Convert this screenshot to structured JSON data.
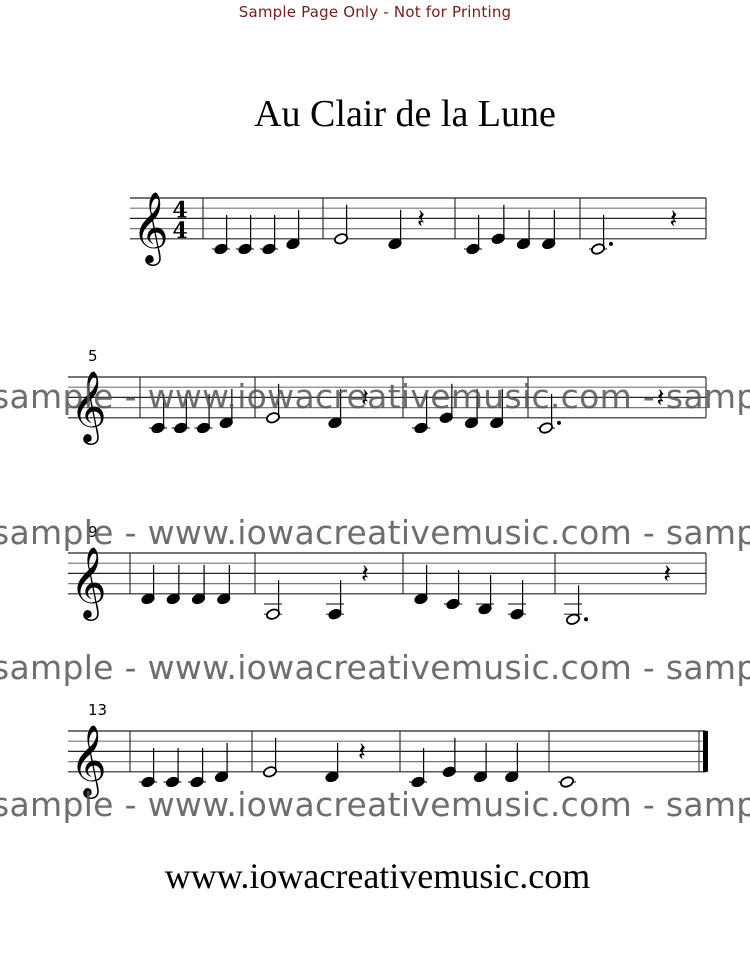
{
  "page": {
    "notice": "Sample Page Only - Not for Printing",
    "title": "Au Clair de la Lune",
    "footer": "www.iowacreativemusic.com",
    "watermark_text": "sample - www.iowacreativemusic.com - sample",
    "colors": {
      "notice": "#7a1a1a",
      "watermark": "#555555",
      "ink": "#000000"
    }
  },
  "score": {
    "clef": "treble",
    "time_signature": {
      "numerator": "4",
      "denominator": "4"
    },
    "systems": [
      {
        "measure_number": "",
        "measures": [
          [
            {
              "p": "C4",
              "d": "q"
            },
            {
              "p": "C4",
              "d": "q"
            },
            {
              "p": "C4",
              "d": "q"
            },
            {
              "p": "D4",
              "d": "q"
            }
          ],
          [
            {
              "p": "E4",
              "d": "h"
            },
            {
              "p": "D4",
              "d": "q"
            },
            {
              "p": "rest",
              "d": "q"
            }
          ],
          [
            {
              "p": "C4",
              "d": "q"
            },
            {
              "p": "E4",
              "d": "q"
            },
            {
              "p": "D4",
              "d": "q"
            },
            {
              "p": "D4",
              "d": "q"
            }
          ],
          [
            {
              "p": "C4",
              "d": "h."
            },
            {
              "p": "rest",
              "d": "q"
            }
          ]
        ]
      },
      {
        "measure_number": "5",
        "measures": [
          [
            {
              "p": "C4",
              "d": "q"
            },
            {
              "p": "C4",
              "d": "q"
            },
            {
              "p": "C4",
              "d": "q"
            },
            {
              "p": "D4",
              "d": "q"
            }
          ],
          [
            {
              "p": "E4",
              "d": "h"
            },
            {
              "p": "D4",
              "d": "q"
            },
            {
              "p": "rest",
              "d": "q"
            }
          ],
          [
            {
              "p": "C4",
              "d": "q"
            },
            {
              "p": "E4",
              "d": "q"
            },
            {
              "p": "D4",
              "d": "q"
            },
            {
              "p": "D4",
              "d": "q"
            }
          ],
          [
            {
              "p": "C4",
              "d": "h."
            },
            {
              "p": "rest",
              "d": "q"
            }
          ]
        ]
      },
      {
        "measure_number": "9",
        "measures": [
          [
            {
              "p": "D4",
              "d": "q"
            },
            {
              "p": "D4",
              "d": "q"
            },
            {
              "p": "D4",
              "d": "q"
            },
            {
              "p": "D4",
              "d": "q"
            }
          ],
          [
            {
              "p": "A3",
              "d": "h"
            },
            {
              "p": "A3",
              "d": "q"
            },
            {
              "p": "rest",
              "d": "q"
            }
          ],
          [
            {
              "p": "D4",
              "d": "q"
            },
            {
              "p": "C4",
              "d": "q"
            },
            {
              "p": "B3",
              "d": "q"
            },
            {
              "p": "A3",
              "d": "q"
            }
          ],
          [
            {
              "p": "G3",
              "d": "h."
            },
            {
              "p": "rest",
              "d": "q"
            }
          ]
        ]
      },
      {
        "measure_number": "13",
        "measures": [
          [
            {
              "p": "C4",
              "d": "q"
            },
            {
              "p": "C4",
              "d": "q"
            },
            {
              "p": "C4",
              "d": "q"
            },
            {
              "p": "D4",
              "d": "q"
            }
          ],
          [
            {
              "p": "E4",
              "d": "h"
            },
            {
              "p": "D4",
              "d": "q"
            },
            {
              "p": "rest",
              "d": "q"
            }
          ],
          [
            {
              "p": "C4",
              "d": "q"
            },
            {
              "p": "E4",
              "d": "q"
            },
            {
              "p": "D4",
              "d": "q"
            },
            {
              "p": "D4",
              "d": "q"
            }
          ],
          [
            {
              "p": "C4",
              "d": "w"
            }
          ]
        ],
        "final_barline": true
      }
    ]
  }
}
